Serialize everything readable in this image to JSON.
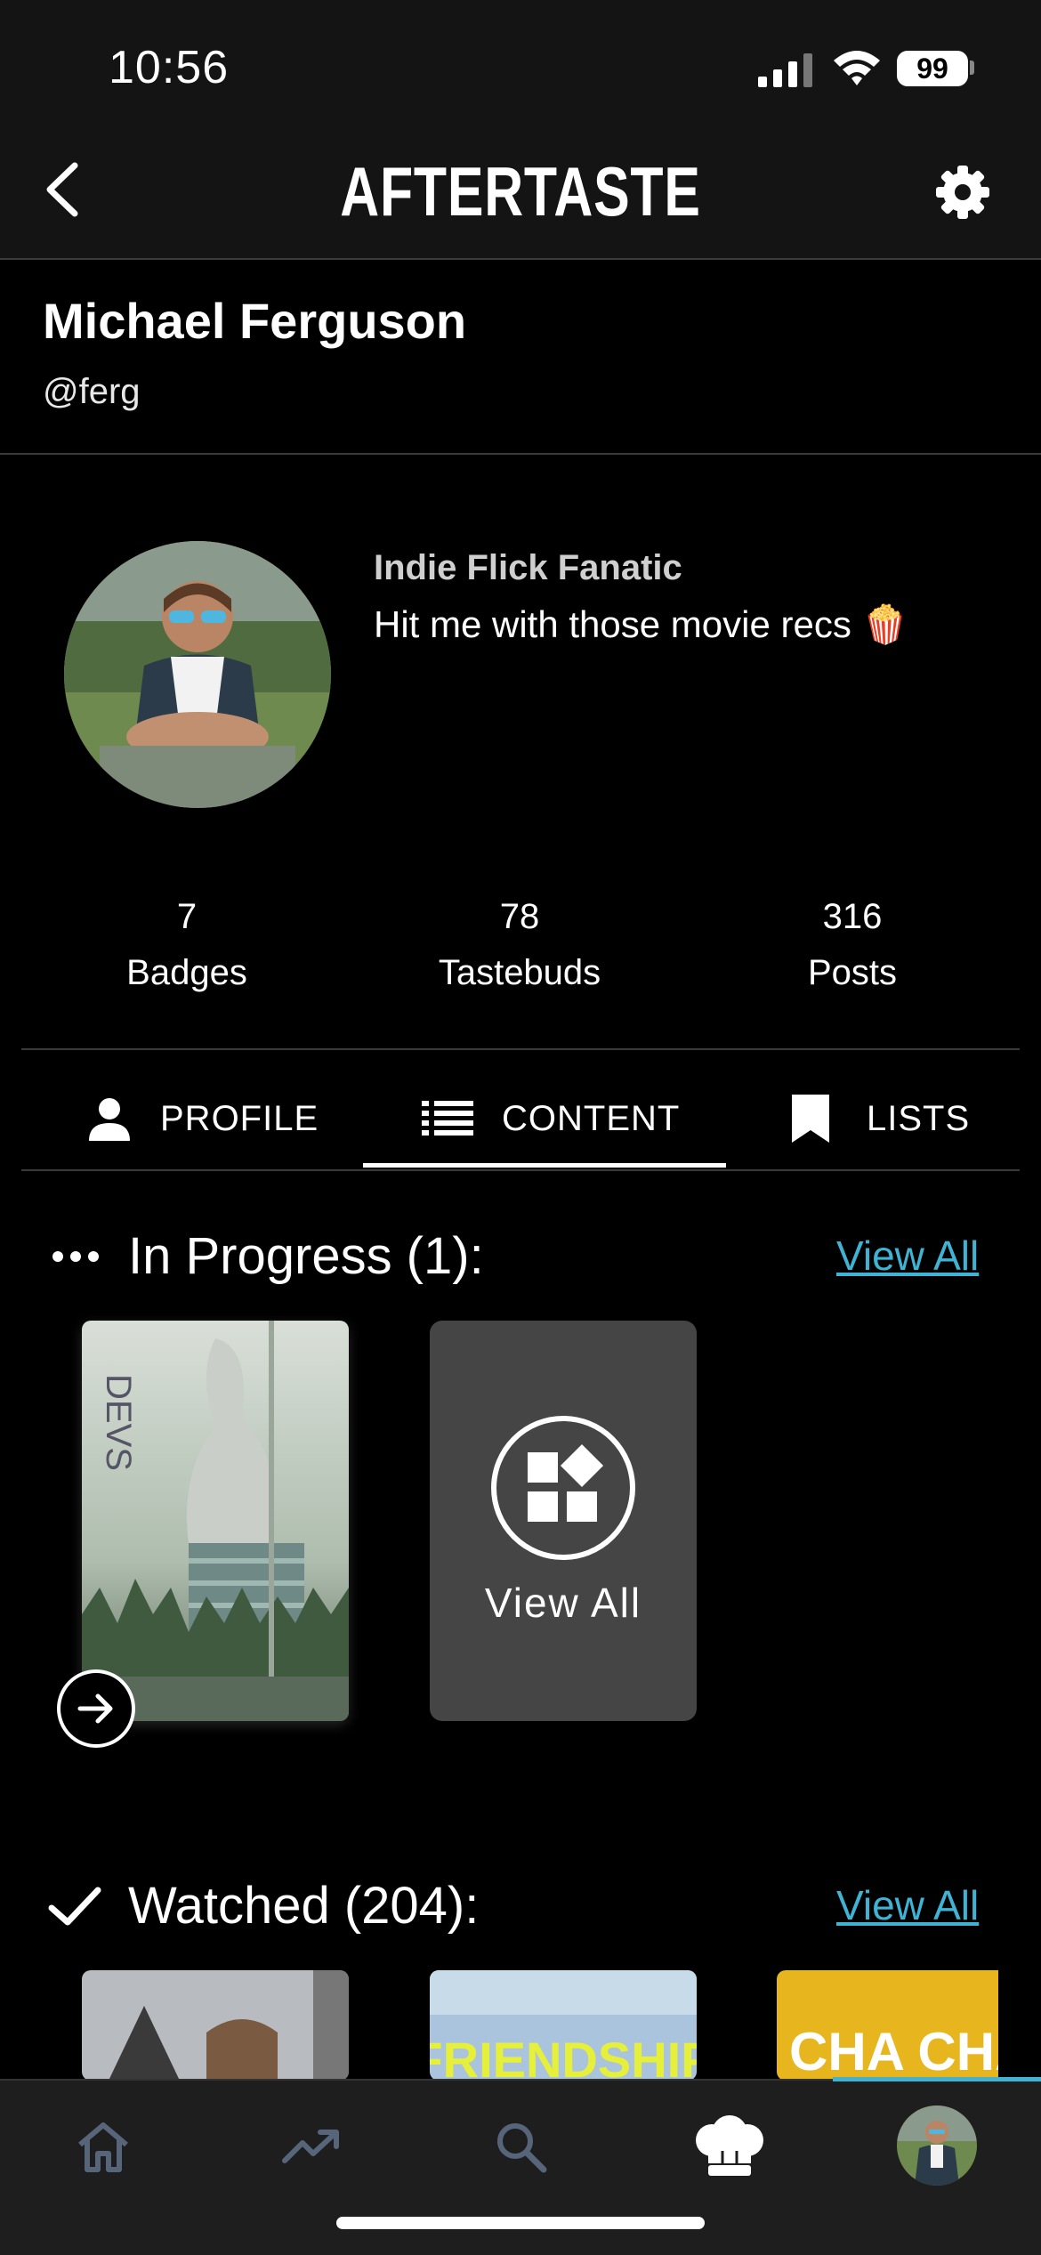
{
  "status": {
    "time": "10:56",
    "battery": "99"
  },
  "header": {
    "title": "AFTERTASTE"
  },
  "profile": {
    "name": "Michael Ferguson",
    "handle": "@ferg",
    "tagline": "Indie Flick Fanatic",
    "bio": "Hit me with those movie recs 🍿",
    "stats": [
      {
        "value": "7",
        "label": "Badges"
      },
      {
        "value": "78",
        "label": "Tastebuds"
      },
      {
        "value": "316",
        "label": "Posts"
      }
    ]
  },
  "tabs": [
    {
      "label": "PROFILE",
      "icon": "person-icon"
    },
    {
      "label": "CONTENT",
      "icon": "list-icon",
      "active": true
    },
    {
      "label": "LISTS",
      "icon": "bookmark-icon"
    }
  ],
  "in_progress": {
    "title": "In Progress (1):",
    "view_all": "View All",
    "card_view_all": "View All",
    "posters": [
      {
        "art_text": "DEVS"
      }
    ]
  },
  "watched": {
    "title": "Watched (204):",
    "view_all": "View All",
    "posters": [
      {
        "art_text": ""
      },
      {
        "art_text": "FRIENDSHIP"
      },
      {
        "art_text": "CHA CHA"
      }
    ]
  },
  "bottom_nav": [
    "home-icon",
    "trending-icon",
    "search-icon",
    "chef-hat-icon",
    "profile-avatar"
  ],
  "colors": {
    "accent": "#3fb3d4",
    "background": "#000000",
    "header": "#141414",
    "card": "#454545"
  }
}
